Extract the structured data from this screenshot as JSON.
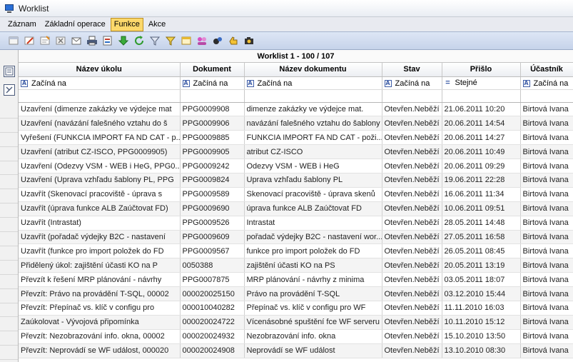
{
  "window": {
    "title": "Worklist"
  },
  "menu": [
    {
      "label": "Záznam",
      "active": false
    },
    {
      "label": "Základní operace",
      "active": false
    },
    {
      "label": "Funkce",
      "active": true
    },
    {
      "label": "Akce",
      "active": false
    }
  ],
  "toolbar": {
    "icons": [
      "new-record-icon",
      "edit-record-icon",
      "edit-form-icon",
      "delete-icon",
      "mail-icon",
      "print-icon",
      "export-icon",
      "move-down-icon",
      "refresh-icon",
      "filter-icon",
      "clear-filter-icon",
      "window-icon",
      "users-icon",
      "tools-icon",
      "hand-point-icon",
      "camera-icon"
    ]
  },
  "worklist": {
    "caption": "Worklist  1 - 100 / 107",
    "columns": [
      "Název úkolu",
      "Dokument",
      "Název dokumentu",
      "Stav",
      "Přišlo",
      "Účastník"
    ],
    "filters": [
      {
        "op": "A",
        "label": "Začíná na"
      },
      {
        "op": "A",
        "label": "Začíná na"
      },
      {
        "op": "A",
        "label": "Začíná na"
      },
      {
        "op": "A",
        "label": "Začíná na"
      },
      {
        "op": "=",
        "label": "Stejné"
      },
      {
        "op": "A",
        "label": "Začíná na"
      }
    ],
    "rows": [
      [
        "Uzavření (dimenze zakázky ve výdejce mat",
        "PPG0009908",
        "dimenze zakázky ve výdejce mat.",
        "Otevřen.Neběží",
        "21.06.2011 10:20",
        "Birtová Ivana"
      ],
      [
        "Uzavření (navázání falešného vztahu do š",
        "PPG0009906",
        "navázání falešného vztahu do šablony",
        "Otevřen.Neběží",
        "20.06.2011 14:54",
        "Birtová Ivana"
      ],
      [
        "Vyřešení (FUNKCIA IMPORT FA ND CAT - p...",
        "PPG0009885",
        "FUNKCIA IMPORT FA ND CAT - poži...",
        "Otevřen.Neběží",
        "20.06.2011 14:27",
        "Birtová Ivana"
      ],
      [
        "Uzavření (atribut CZ-ISCO, PPG0009905)",
        "PPG0009905",
        "atribut CZ-ISCO",
        "Otevřen.Neběží",
        "20.06.2011 10:49",
        "Birtová Ivana"
      ],
      [
        "Uzavření (Odezvy VSM - WEB i HeG, PPG0...",
        "PPG0009242",
        "Odezvy VSM - WEB i HeG",
        "Otevřen.Neběží",
        "20.06.2011 09:29",
        "Birtová Ivana"
      ],
      [
        "Uzavření (Uprava vzhľadu šablony PL, PPG",
        "PPG0009824",
        "Uprava vzhľadu šablony PL",
        "Otevřen.Neběží",
        "19.06.2011 22:28",
        "Birtová Ivana"
      ],
      [
        "Uzavřít (Skenovací pracoviště - úprava s",
        "PPG0009589",
        "Skenovací pracoviště - úprava skenů",
        "Otevřen.Neběží",
        "16.06.2011 11:34",
        "Birtová Ivana"
      ],
      [
        "Uzavřít (úprava funkce ALB Zaúčtovat FD)",
        "PPG0009690",
        "úprava funkce ALB Zaúčtovat FD",
        "Otevřen.Neběží",
        "10.06.2011 09:51",
        "Birtová Ivana"
      ],
      [
        "Uzavřít (Intrastat)",
        "PPG0009526",
        "Intrastat",
        "Otevřen.Neběží",
        "28.05.2011 14:48",
        "Birtová Ivana"
      ],
      [
        "Uzavřít (pořadač výdejky B2C - nastavení",
        "PPG0009609",
        "pořadač výdejky B2C - nastavení wor...",
        "Otevřen.Neběží",
        "27.05.2011 16:58",
        "Birtová Ivana"
      ],
      [
        "Uzavřít (funkce pro import položek do FD",
        "PPG0009567",
        "funkce pro import položek do FD",
        "Otevřen.Neběží",
        "26.05.2011 08:45",
        "Birtová Ivana"
      ],
      [
        "Přidělený úkol: zajištění účasti KO na P",
        "0050388",
        "zajištění účasti KO na PS",
        "Otevřen.Neběží",
        "20.05.2011 13:19",
        "Birtová Ivana"
      ],
      [
        "Převzít k řešení MRP plánování - návrhy",
        "PPG0007875",
        "MRP plánování - návrhy z minima",
        "Otevřen.Neběží",
        "03.05.2011 18:07",
        "Birtová Ivana"
      ],
      [
        "Převzít: Právo na provádění T-SQL, 00002",
        "000020025150",
        "Právo na provádění T-SQL",
        "Otevřen.Neběží",
        "03.12.2010 15:44",
        "Birtová Ivana"
      ],
      [
        "Převzít: Přepínač vs. klíč v configu pro",
        "000010040282",
        "Přepínač vs. klíč v configu pro WF",
        "Otevřen.Neběží",
        "11.11.2010 16:03",
        "Birtová Ivana"
      ],
      [
        "Zaúkolovat - Vývojová připomínka",
        "000020024722",
        "Vícenásobné spuštění fce WF serveru",
        "Otevřen.Neběží",
        "10.11.2010 15:12",
        "Birtová Ivana"
      ],
      [
        "Převzít: Nezobrazování info. okna, 00002",
        "000020024932",
        "Nezobrazování info. okna",
        "Otevřen.Neběží",
        "15.10.2010 13:50",
        "Birtová Ivana"
      ],
      [
        "Převzít: Neprovádí se WF událost, 000020",
        "000020024908",
        "Neprovádí se WF událost",
        "Otevřen.Neběží",
        "13.10.2010 08:30",
        "Birtová Ivana"
      ]
    ]
  }
}
